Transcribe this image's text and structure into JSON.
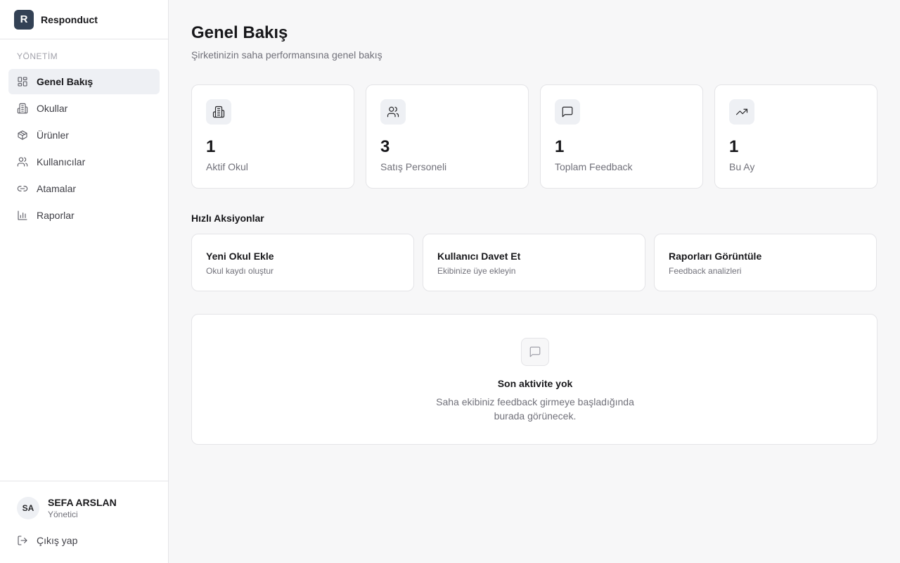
{
  "brand": {
    "logo_letter": "R",
    "name": "Responduct"
  },
  "sidebar": {
    "section_label": "YÖNETİM",
    "items": [
      {
        "label": "Genel Bakış",
        "icon": "dashboard-icon",
        "active": true
      },
      {
        "label": "Okullar",
        "icon": "building-icon"
      },
      {
        "label": "Ürünler",
        "icon": "package-icon"
      },
      {
        "label": "Kullanıcılar",
        "icon": "users-icon"
      },
      {
        "label": "Atamalar",
        "icon": "link-icon"
      },
      {
        "label": "Raporlar",
        "icon": "bar-chart-icon"
      }
    ],
    "user": {
      "initials": "SA",
      "name": "SEFA ARSLAN",
      "role": "Yönetici"
    },
    "logout_label": "Çıkış yap"
  },
  "header": {
    "title": "Genel Bakış",
    "subtitle": "Şirketinizin saha performansına genel bakış"
  },
  "stats": [
    {
      "value": "1",
      "label": "Aktif Okul",
      "icon": "building-icon"
    },
    {
      "value": "3",
      "label": "Satış Personeli",
      "icon": "users-icon"
    },
    {
      "value": "1",
      "label": "Toplam Feedback",
      "icon": "message-icon"
    },
    {
      "value": "1",
      "label": "Bu Ay",
      "icon": "trending-up-icon"
    }
  ],
  "quick_actions": {
    "title": "Hızlı Aksiyonlar",
    "items": [
      {
        "title": "Yeni Okul Ekle",
        "desc": "Okul kaydı oluştur"
      },
      {
        "title": "Kullanıcı Davet Et",
        "desc": "Ekibinize üye ekleyin"
      },
      {
        "title": "Raporları Görüntüle",
        "desc": "Feedback analizleri"
      }
    ]
  },
  "activity": {
    "title": "Son aktivite yok",
    "desc": "Saha ekibiniz feedback girmeye başladığında burada görünecek.",
    "icon": "message-icon"
  },
  "colors": {
    "accent": "#334155",
    "active_bg": "#eef0f4",
    "border": "#e4e4e7",
    "muted_text": "#71717a"
  }
}
